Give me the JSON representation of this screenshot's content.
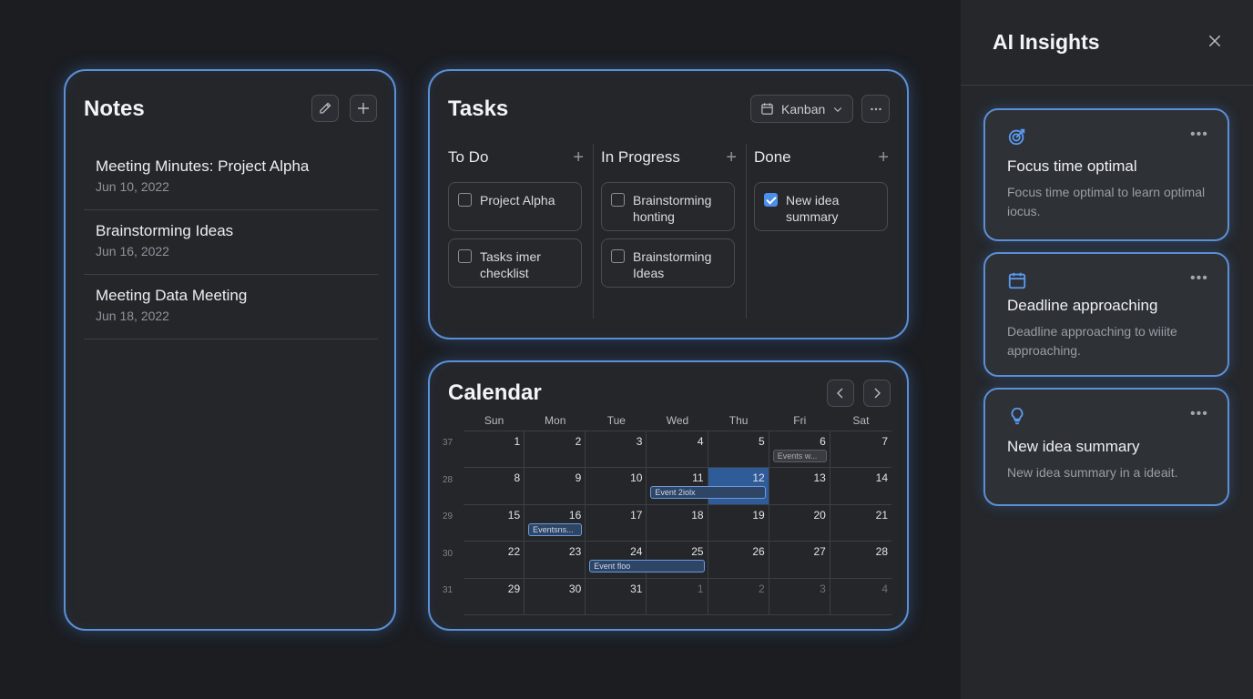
{
  "notes": {
    "title": "Notes",
    "items": [
      {
        "title": "Meeting Minutes: Project Alpha",
        "date": "Jun 10, 2022"
      },
      {
        "title": "Brainstorming Ideas",
        "date": "Jun 16, 2022"
      },
      {
        "title": "Meeting Data Meeting",
        "date": "Jun 18, 2022"
      }
    ]
  },
  "tasks": {
    "title": "Tasks",
    "view_label": "Kanban",
    "columns": [
      {
        "name": "To Do",
        "cards": [
          {
            "text": "Project Alpha",
            "checked": false
          },
          {
            "text": "Tasks imer checklist",
            "checked": false
          }
        ]
      },
      {
        "name": "In Progress",
        "cards": [
          {
            "text": "Brainstorming honting",
            "checked": false
          },
          {
            "text": "Brainstorming Ideas",
            "checked": false
          }
        ]
      },
      {
        "name": "Done",
        "cards": [
          {
            "text": "New idea summary",
            "checked": true
          }
        ]
      }
    ]
  },
  "calendar": {
    "title": "Calendar",
    "weekdays": [
      "Sun",
      "Mon",
      "Tue",
      "Wed",
      "Thu",
      "Fri",
      "Sat"
    ],
    "week_numbers": [
      "37",
      "28",
      "29",
      "30",
      "31"
    ],
    "days": [
      "1",
      "2",
      "3",
      "4",
      "5",
      "6",
      "7",
      "8",
      "9",
      "10",
      "11",
      "12",
      "13",
      "14",
      "15",
      "16",
      "17",
      "18",
      "19",
      "20",
      "21",
      "22",
      "23",
      "24",
      "25",
      "26",
      "27",
      "28",
      "29",
      "30",
      "31",
      "1",
      "2",
      "3",
      "4"
    ],
    "dim_from": 31,
    "today_index": 11,
    "events": [
      {
        "label": "Events w...",
        "start": 5,
        "span": 1,
        "style": "grey"
      },
      {
        "label": "Event 2iolx",
        "start": 10,
        "span": 2,
        "style": "blue"
      },
      {
        "label": "Eventsns...",
        "start": 15,
        "span": 1,
        "style": "blue"
      },
      {
        "label": "Event floo",
        "start": 23,
        "span": 2,
        "style": "blue"
      }
    ]
  },
  "sidebar": {
    "title": "AI Insights",
    "insights": [
      {
        "icon": "target-icon",
        "title": "Focus time optimal",
        "body": "Focus time optimal to learn optimal iocus."
      },
      {
        "icon": "calendar-icon",
        "title": "Deadline approaching",
        "body": "Deadline approaching to wiiite approaching."
      },
      {
        "icon": "lightbulb-icon",
        "title": "New idea summary",
        "body": "New idea summary in a ideait."
      }
    ]
  },
  "colors": {
    "accent": "#5b8fd6",
    "today": "#2f5c99",
    "background": "#1b1d21"
  }
}
